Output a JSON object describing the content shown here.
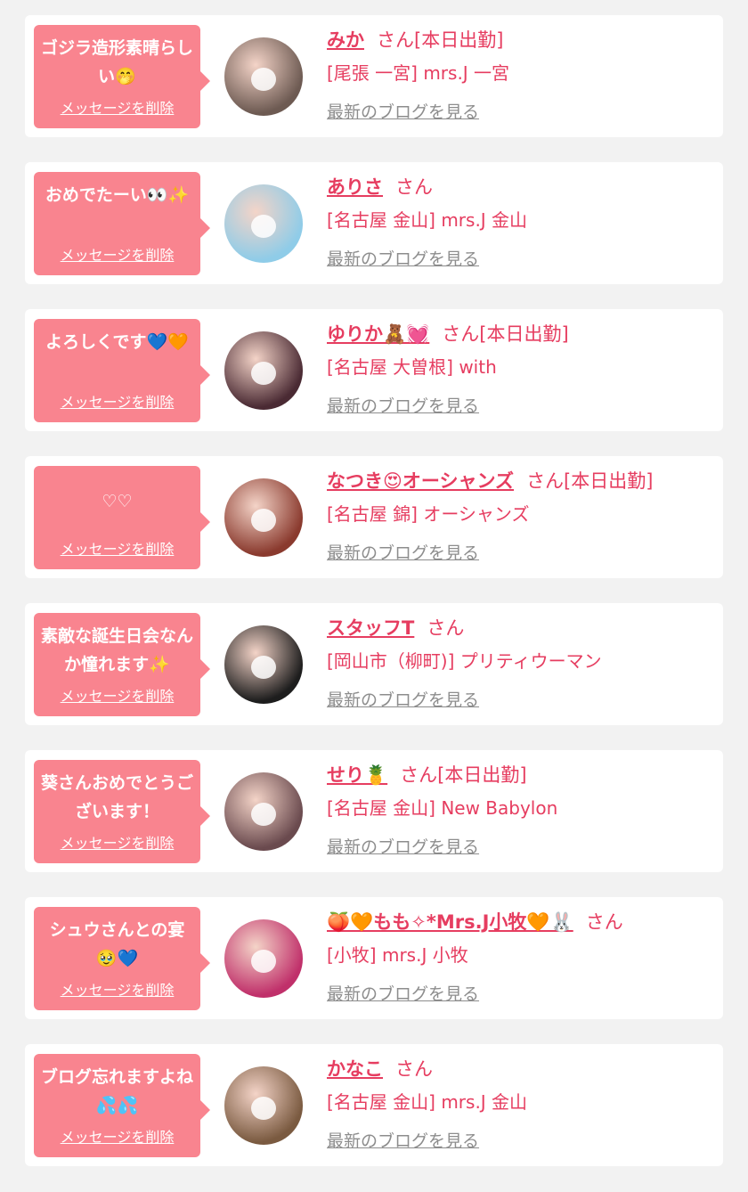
{
  "items": [
    {
      "message": "ゴジラ造形素晴らしい🤭",
      "delete_label": "メッセージを削除",
      "name": "みか",
      "honorific": "さん[本日出勤]",
      "shop": "[尾張 一宮] mrs.J 一宮",
      "blog_label": "最新のブログを見る",
      "avatar_color": "#6d5a52"
    },
    {
      "message": "おめでたーい👀✨",
      "delete_label": "メッセージを削除",
      "name": "ありさ",
      "honorific": "さん",
      "shop": "[名古屋 金山] mrs.J 金山",
      "blog_label": "最新のブログを見る",
      "avatar_color": "#8fcce8"
    },
    {
      "message": "よろしくです💙🧡",
      "delete_label": "メッセージを削除",
      "name": "ゆりか🧸💓",
      "honorific": "さん[本日出勤]",
      "shop": "[名古屋 大曽根] with",
      "blog_label": "最新のブログを見る",
      "avatar_color": "#4a2a33"
    },
    {
      "message": "♡♡",
      "delete_label": "メッセージを削除",
      "name": "なつき😍オーシャンズ",
      "honorific": "さん[本日出勤]",
      "shop": "[名古屋 錦] オーシャンズ",
      "blog_label": "最新のブログを見る",
      "avatar_color": "#8a3a2e"
    },
    {
      "message": "素敵な誕生日会なんか憧れます✨",
      "delete_label": "メッセージを削除",
      "name": "スタッフT",
      "honorific": "さん",
      "shop": "[岡山市（柳町)] プリティウーマン",
      "blog_label": "最新のブログを見る",
      "avatar_color": "#1d1d1d"
    },
    {
      "message": "葵さんおめでとうございます！",
      "delete_label": "メッセージを削除",
      "name": "せり🍍",
      "honorific": "さん[本日出勤]",
      "shop": "[名古屋 金山] New Babylon",
      "blog_label": "最新のブログを見る",
      "avatar_color": "#6a4a4e"
    },
    {
      "message": "シュウさんとの宴🥹💙",
      "delete_label": "メッセージを削除",
      "name": "🍑🧡もも✧*Mrs.J小牧🧡🐰",
      "honorific": "さん",
      "shop": "[小牧] mrs.J 小牧",
      "blog_label": "最新のブログを見る",
      "avatar_color": "#c0306a"
    },
    {
      "message": "ブログ忘れますよね💦💦",
      "delete_label": "メッセージを削除",
      "name": "かなこ",
      "honorific": "さん",
      "shop": "[名古屋 金山] mrs.J 金山",
      "blog_label": "最新のブログを見る",
      "avatar_color": "#7a5a40"
    }
  ]
}
